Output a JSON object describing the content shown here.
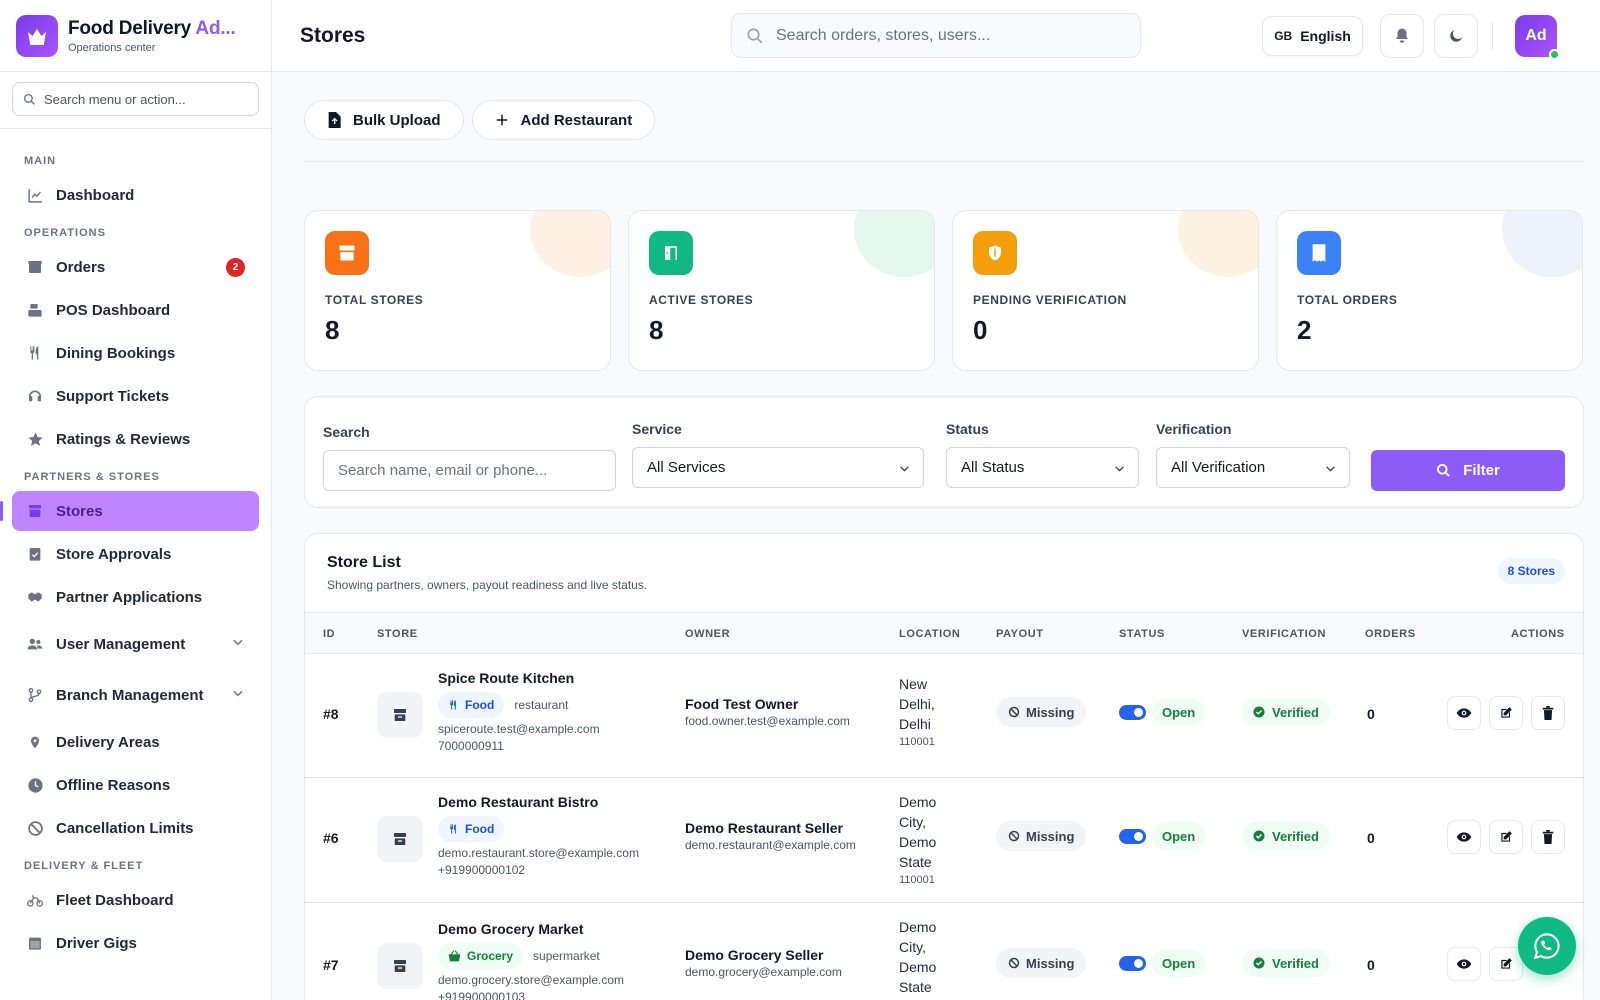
{
  "brand": {
    "title_main": "Food Delivery ",
    "title_accent": "Ad...",
    "subtitle": "Operations center"
  },
  "sidebar": {
    "search_placeholder": "Search menu or action...",
    "sections": {
      "main": "MAIN",
      "operations": "OPERATIONS",
      "partners": "PARTNERS & STORES",
      "delivery": "DELIVERY & FLEET"
    },
    "items": {
      "dashboard": "Dashboard",
      "orders": "Orders",
      "orders_badge": "2",
      "pos": "POS Dashboard",
      "dining": "Dining Bookings",
      "support": "Support Tickets",
      "ratings": "Ratings & Reviews",
      "stores": "Stores",
      "approvals": "Store Approvals",
      "partner_apps": "Partner Applications",
      "user_mgmt": "User Management",
      "branch_mgmt": "Branch Management",
      "delivery_areas": "Delivery Areas",
      "offline_reasons": "Offline Reasons",
      "cancellation": "Cancellation Limits",
      "fleet": "Fleet Dashboard",
      "driver_gigs": "Driver Gigs"
    }
  },
  "header": {
    "title": "Stores",
    "search_placeholder": "Search orders, stores, users...",
    "lang_flag": "GB",
    "lang_label": "English",
    "avatar": "Ad"
  },
  "actions": {
    "bulk_upload": "Bulk Upload",
    "add_restaurant": "Add Restaurant"
  },
  "stats": [
    {
      "label": "TOTAL STORES",
      "value": "8",
      "color": "#f97316",
      "blob": "#fff1e6"
    },
    {
      "label": "ACTIVE STORES",
      "value": "8",
      "color": "#10b981",
      "blob": "#e6f7ef"
    },
    {
      "label": "PENDING VERIFICATION",
      "value": "0",
      "color": "#f59e0b",
      "blob": "#fef3e2"
    },
    {
      "label": "TOTAL ORDERS",
      "value": "2",
      "color": "#3b82f6",
      "blob": "#eef2fb"
    }
  ],
  "filters": {
    "search_label": "Search",
    "search_placeholder": "Search name, email or phone...",
    "service_label": "Service",
    "service_value": "All Services",
    "status_label": "Status",
    "status_value": "All Status",
    "verification_label": "Verification",
    "verification_value": "All Verification",
    "filter_btn": "Filter"
  },
  "store_list": {
    "title": "Store List",
    "subtitle": "Showing partners, owners, payout readiness and live status.",
    "count": "8 Stores",
    "columns": {
      "id": "ID",
      "store": "STORE",
      "owner": "OWNER",
      "location": "LOCATION",
      "payout": "PAYOUT",
      "status": "STATUS",
      "verification": "VERIFICATION",
      "orders": "ORDERS",
      "actions": "ACTIONS"
    },
    "rows": [
      {
        "id": "#8",
        "name": "Spice Route Kitchen",
        "service": "Food",
        "type": "restaurant",
        "email": "spiceroute.test@example.com",
        "phone": "7000000911",
        "owner": "Food Test Owner",
        "owner_email": "food.owner.test@example.com",
        "loc1": "New",
        "loc2": "Delhi,",
        "loc3": "Delhi",
        "zip": "110001",
        "payout": "Missing",
        "status": "Open",
        "verification": "Verified",
        "orders": "0"
      },
      {
        "id": "#6",
        "name": "Demo Restaurant Bistro",
        "service": "Food",
        "type": "",
        "email": "demo.restaurant.store@example.com",
        "phone": "+919900000102",
        "owner": "Demo Restaurant Seller",
        "owner_email": "demo.restaurant@example.com",
        "loc1": "Demo",
        "loc2": "City,",
        "loc3": "Demo",
        "loc4": "State",
        "zip": "110001",
        "payout": "Missing",
        "status": "Open",
        "verification": "Verified",
        "orders": "0"
      },
      {
        "id": "#7",
        "name": "Demo Grocery Market",
        "service": "Grocery",
        "type": "supermarket",
        "email": "demo.grocery.store@example.com",
        "phone": "+919900000103",
        "owner": "Demo Grocery Seller",
        "owner_email": "demo.grocery@example.com",
        "loc1": "Demo",
        "loc2": "City,",
        "loc3": "Demo",
        "loc4": "State",
        "payout": "Missing",
        "status": "Open",
        "verification": "Verified",
        "orders": "0"
      }
    ]
  }
}
